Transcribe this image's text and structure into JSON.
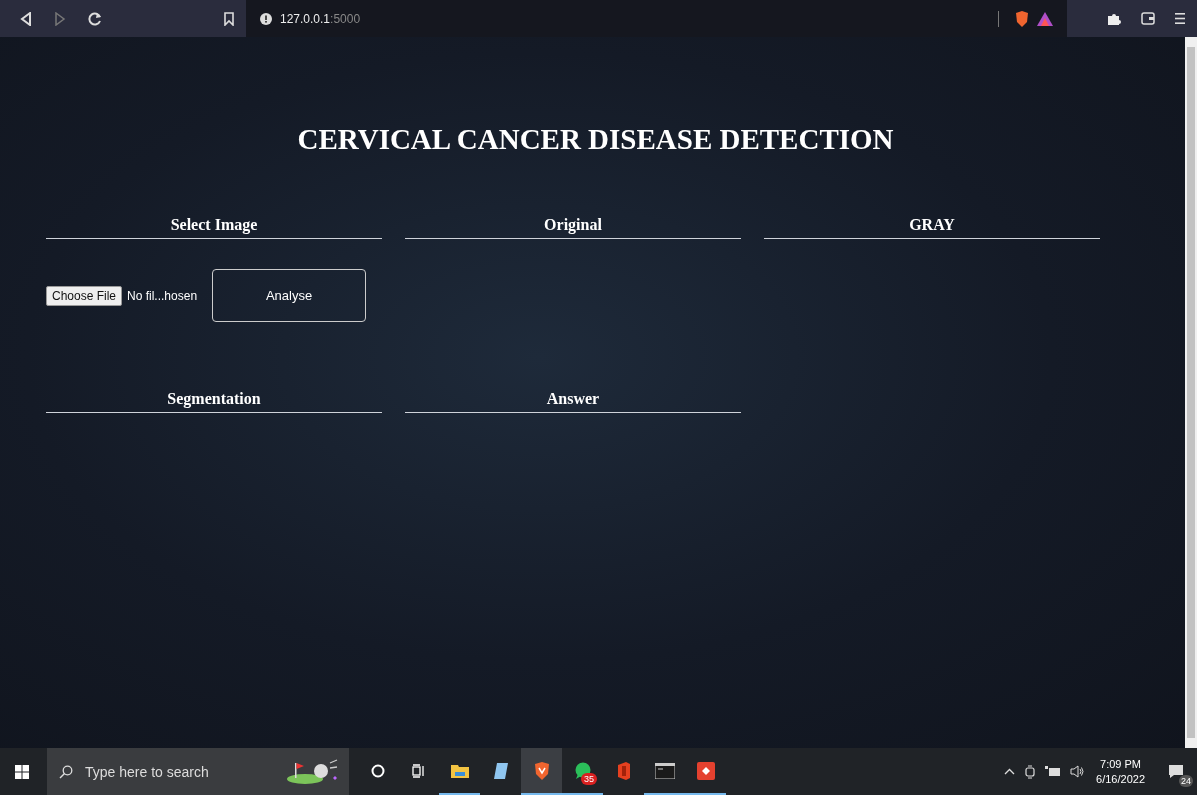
{
  "browser": {
    "address": {
      "host": "127.0.0.1",
      "port": ":5000"
    }
  },
  "page": {
    "title": "CERVICAL CANCER DISEASE DETECTION",
    "sections": [
      {
        "kind": "upload",
        "heading": "Select Image"
      },
      {
        "kind": "panel",
        "heading": "Original"
      },
      {
        "kind": "panel",
        "heading": "GRAY"
      },
      {
        "kind": "panel",
        "heading": "Segmentation"
      },
      {
        "kind": "panel",
        "heading": "Answer"
      }
    ],
    "file_input": {
      "button": "Choose File",
      "status": "No fil...hosen"
    },
    "analyse_button": "Analyse"
  },
  "taskbar": {
    "search": {
      "placeholder": "Type here to search"
    },
    "apps": [
      {
        "kind": "cortana",
        "open": false,
        "selected": false
      },
      {
        "kind": "taskview",
        "open": false,
        "selected": false
      },
      {
        "kind": "explorer",
        "open": true,
        "selected": false
      },
      {
        "kind": "notes",
        "open": false,
        "selected": false
      },
      {
        "kind": "brave",
        "open": true,
        "selected": true
      },
      {
        "kind": "whatsapp",
        "open": true,
        "selected": false,
        "badge": "35"
      },
      {
        "kind": "office",
        "open": false,
        "selected": false
      },
      {
        "kind": "terminal",
        "open": true,
        "selected": false
      },
      {
        "kind": "redapp",
        "open": true,
        "selected": false
      }
    ],
    "time": "7:09 PM",
    "date": "6/16/2022",
    "notifications": "24"
  }
}
